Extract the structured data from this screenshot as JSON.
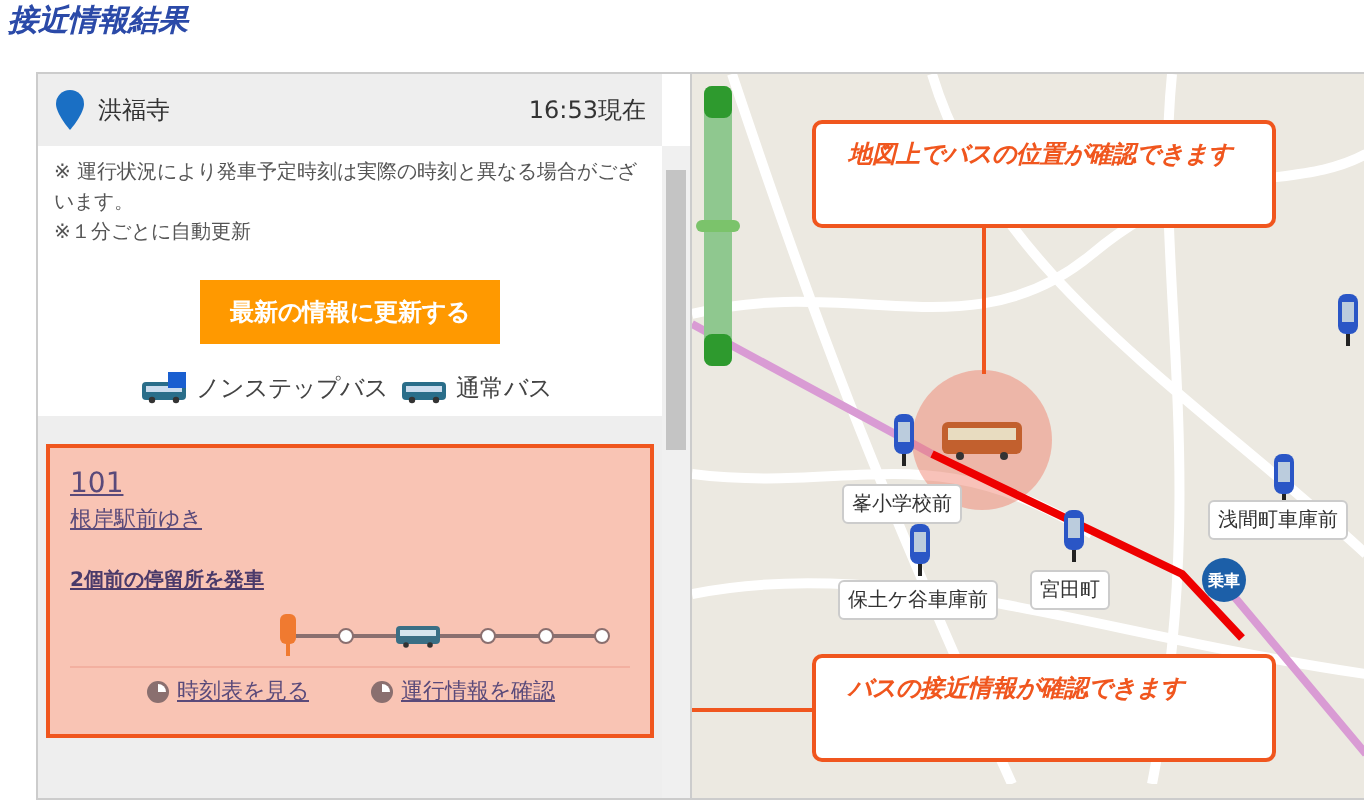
{
  "page_title": "接近情報結果",
  "stop": {
    "name": "洪福寺",
    "time": "16:53現在"
  },
  "notes": [
    "※ 運行状況により発車予定時刻は実際の時刻と異なる場合がございます。",
    "※１分ごとに自動更新"
  ],
  "refresh_button": "最新の情報に更新する",
  "legend": [
    {
      "kind": "nonstep",
      "label": "ノンステップバス"
    },
    {
      "kind": "normal",
      "label": "通常バス"
    }
  ],
  "route": {
    "number": "101",
    "destination": "根岸駅前ゆき",
    "status": "2個前の停留所を発車",
    "track": [
      {
        "kind": "stop"
      },
      {
        "kind": "node"
      },
      {
        "kind": "bus"
      },
      {
        "kind": "node"
      },
      {
        "kind": "node"
      },
      {
        "kind": "node"
      }
    ],
    "links": [
      "時刻表を見る",
      "運行情報を確認"
    ]
  },
  "map": {
    "zoom": {
      "level": 0.5
    },
    "stop_labels": [
      "峯小学校前",
      "保土ケ谷車庫前",
      "宮田町",
      "浅間町車庫前"
    ],
    "boarding_marker": "乗車",
    "callouts": [
      "地図上でバスの位置が確認できます",
      "バスの接近情報が確認できます"
    ]
  }
}
